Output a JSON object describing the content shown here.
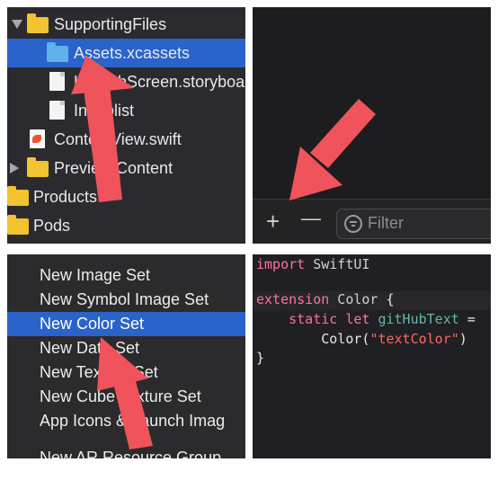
{
  "navigator": {
    "items": [
      {
        "label": "SupportingFiles"
      },
      {
        "label": "Assets.xcassets"
      },
      {
        "label": "LaunchScreen.storyboa"
      },
      {
        "label": "Info.plist"
      },
      {
        "label": "ContentView.swift"
      },
      {
        "label": "Preview Content"
      },
      {
        "label": "Products"
      },
      {
        "label": "Pods"
      }
    ]
  },
  "toolbar": {
    "add_symbol": "+",
    "remove_symbol": "—",
    "filter_placeholder": "Filter"
  },
  "context_menu": {
    "items": [
      {
        "label": "New Image Set"
      },
      {
        "label": "New Symbol Image Set"
      },
      {
        "label": "New Color Set",
        "highlighted": true
      },
      {
        "label": "New Data Set"
      },
      {
        "label": "New Texture Set"
      },
      {
        "label": "New Cube Texture Set"
      },
      {
        "label": "App Icons & Launch Imag"
      },
      {
        "label": "New AR Resource Group"
      }
    ]
  },
  "code": {
    "line1_kw": "import",
    "line1_rest": " SwiftUI",
    "line3_kw": "extension",
    "line3_type": " Color",
    "line3_brace": " {",
    "line4_kw": "    static let",
    "line4_id": " gitHubText",
    "line4_eq": " =",
    "line5_call": "        Color(",
    "line5_str": "\"textColor\"",
    "line5_close": ")",
    "line6": "}"
  },
  "colors": {
    "selection": "#2a63c9",
    "arrow": "#f0535b",
    "folder": "#f2c230",
    "keyword": "#ff6fa8"
  },
  "icons": [
    "disclosure-triangle-icon",
    "folder-icon",
    "asset-catalog-icon",
    "storyboard-file-icon",
    "plist-file-icon",
    "swift-file-icon",
    "plus-icon",
    "minus-icon",
    "filter-icon"
  ]
}
